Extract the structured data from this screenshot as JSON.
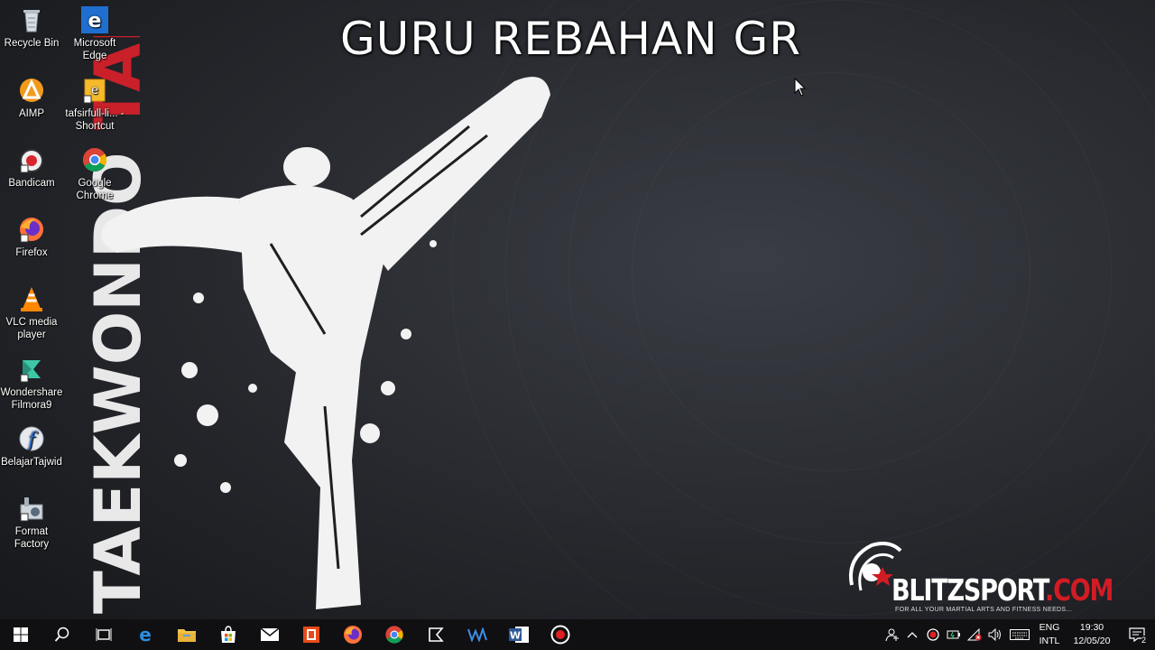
{
  "overlay": {
    "title": "GURU REBAHAN GR"
  },
  "wallpaper": {
    "vertical_text_red": "TAEKWONDO",
    "vertical_text_white": "TAEKWONDO",
    "brand_main": "BLITZSPORT",
    "brand_suffix": ".COM",
    "brand_tagline": "FOR ALL YOUR MARTIAL ARTS AND FITNESS NEEDS...",
    "accent": "#c9202a"
  },
  "desktop_icons": [
    {
      "label": "Recycle Bin",
      "icon": "recycle-bin-icon"
    },
    {
      "label": "Microsoft Edge",
      "icon": "edge-icon"
    },
    {
      "label": "AIMP",
      "icon": "aimp-icon"
    },
    {
      "label": "tafsirfull-li... - Shortcut",
      "icon": "shortcut-file-icon"
    },
    {
      "label": "Bandicam",
      "icon": "bandicam-icon"
    },
    {
      "label": "Google Chrome",
      "icon": "chrome-icon"
    },
    {
      "label": "Firefox",
      "icon": "firefox-icon"
    },
    {
      "label": "VLC media player",
      "icon": "vlc-icon"
    },
    {
      "label": "Wondershare Filmora9",
      "icon": "filmora-icon"
    },
    {
      "label": "BelajarTajwid",
      "icon": "flash-icon"
    },
    {
      "label": "Format Factory",
      "icon": "format-factory-icon"
    }
  ],
  "taskbar": {
    "apps": [
      "start",
      "search",
      "task-view",
      "edge",
      "file-explorer",
      "store",
      "mail",
      "office",
      "firefox",
      "chrome",
      "filmora",
      "wavepad",
      "word",
      "bandicam"
    ],
    "lang_1": "ENG",
    "lang_2": "INTL",
    "time": "19:30",
    "date": "12/05/20",
    "notifications": "2"
  }
}
